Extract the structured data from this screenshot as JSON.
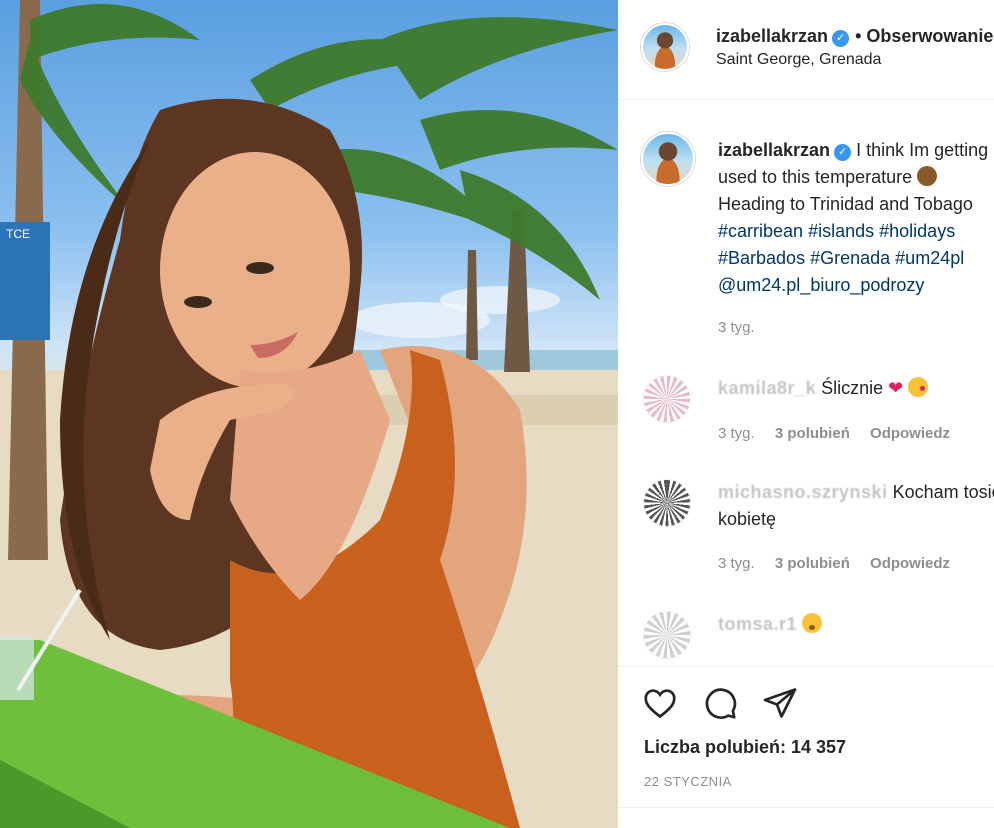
{
  "header": {
    "username": "izabellakrzan",
    "separator": "•",
    "follow_label": "Obserwowanie",
    "location": "Saint George, Grenada"
  },
  "caption": {
    "username": "izabellakrzan",
    "line1": "I think Im getting",
    "line2": "used to this temperature",
    "line3": "Heading to Trinidad and Tobago",
    "hashtags_line1": [
      "#carribean",
      "#islands",
      "#holidays"
    ],
    "hashtags_line2": [
      "#Barbados",
      "#Grenada",
      "#um24pl"
    ],
    "mention": "@um24.pl_biuro_podrozy",
    "time": "3 tyg."
  },
  "comments": [
    {
      "username": "kamila8r_k",
      "text": "Ślicznie",
      "emojis": [
        "red-heart",
        "face-blowing-kiss"
      ],
      "time": "3 tyg.",
      "likes": "3 polubień",
      "reply": "Odpowiedz"
    },
    {
      "username": "michasno.szrynski",
      "text": "Kocham tosię",
      "text_line2": "kobietę",
      "time": "3 tyg.",
      "likes": "3 polubień",
      "reply": "Odpowiedz"
    },
    {
      "username": "tomsa.r1",
      "text": "",
      "emojis": [
        "hushed-face"
      ]
    }
  ],
  "actions": {
    "like_icon": "heart-icon",
    "comment_icon": "comment-icon",
    "share_icon": "paper-plane-icon",
    "likes_label": "Liczba polubień: 14 357",
    "date": "22 STYCZNIA"
  },
  "colors": {
    "text": "#262626",
    "muted": "#8e8e8e",
    "link": "#00376b",
    "verified": "#3897f0",
    "heart": "#e0245e"
  }
}
